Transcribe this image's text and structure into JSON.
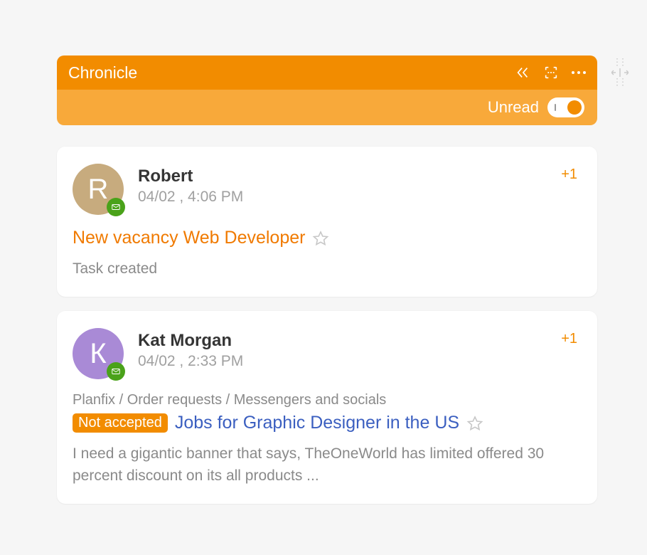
{
  "header": {
    "title": "Chronicle",
    "filter_label": "Unread",
    "filter_on": true
  },
  "colors": {
    "accent": "#f28c00",
    "accent_light": "#f8a93a",
    "link_blue": "#3b5fc0"
  },
  "cards": [
    {
      "author": "Robert",
      "initial": "R",
      "avatar_color": "#c7ab7e",
      "timestamp": "04/02 , 4:06 PM",
      "count_badge": "+1",
      "breadcrumb": "",
      "status_tag": "",
      "title": "New vacancy Web Developer",
      "title_style": "orange",
      "starred": false,
      "snippet": "Task created"
    },
    {
      "author": "Kat Morgan",
      "initial": "К",
      "avatar_color": "#a98ad6",
      "timestamp": "04/02 , 2:33 PM",
      "count_badge": "+1",
      "breadcrumb": "Planfix / Order requests / Messengers and socials",
      "status_tag": "Not accepted",
      "title": "Jobs for Graphic Designer in the US",
      "title_style": "blue",
      "starred": false,
      "snippet": "I need a gigantic banner that says, TheOneWorld has limited offered 30 percent discount on its all products ..."
    }
  ]
}
